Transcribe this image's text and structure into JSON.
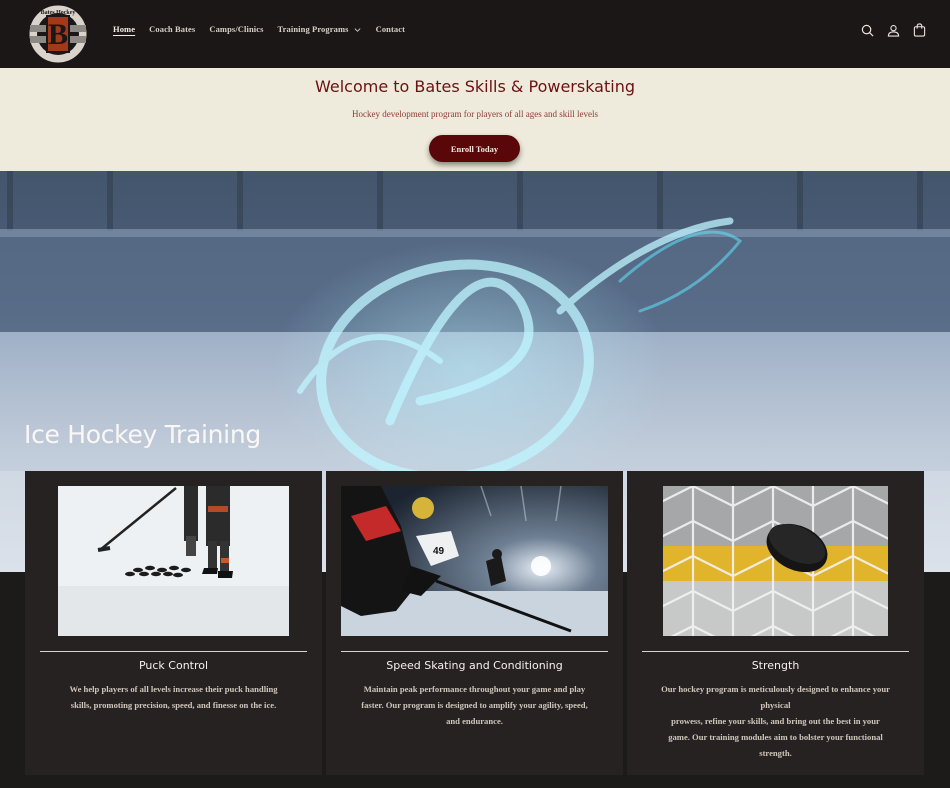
{
  "header": {
    "logo_alt": "Bates Hockey Skills and Powerskating",
    "logo_text_top": "Bates Hockey",
    "logo_letter": "B",
    "nav": [
      {
        "label": "Home",
        "active": true
      },
      {
        "label": "Coach Bates"
      },
      {
        "label": "Camps/Clinics"
      },
      {
        "label": "Training Programs",
        "dropdown": true
      },
      {
        "label": "Contact"
      }
    ],
    "icons": [
      "search-icon",
      "account-icon",
      "cart-icon"
    ]
  },
  "banner": {
    "title": "Welcome to Bates Skills & Powerskating",
    "subtitle": "Hockey development program for players of all ages and skill levels",
    "button": "Enroll Today"
  },
  "hero": {
    "title": "Ice Hockey Training"
  },
  "cards": [
    {
      "title": "Puck Control",
      "lines": [
        "We help players of all levels increase their puck handling",
        "skills, promoting precision, speed, and finesse on the ice."
      ]
    },
    {
      "title": "Speed Skating and Conditioning",
      "lines": [
        "Maintain peak performance throughout your game and play",
        "faster. Our program is designed to amplify your agility, speed,",
        "and endurance."
      ]
    },
    {
      "title": "Strength",
      "lines": [
        "Our hockey program is meticulously designed to enhance your",
        "physical",
        "prowess, refine your skills, and bring out the best in your",
        "game. Our training modules aim to bolster your functional",
        "strength."
      ]
    }
  ],
  "colors": {
    "header_bg": "#1b1717",
    "banner_bg": "#efebdc",
    "accent": "#5a070a",
    "card_bg": "#262222"
  }
}
